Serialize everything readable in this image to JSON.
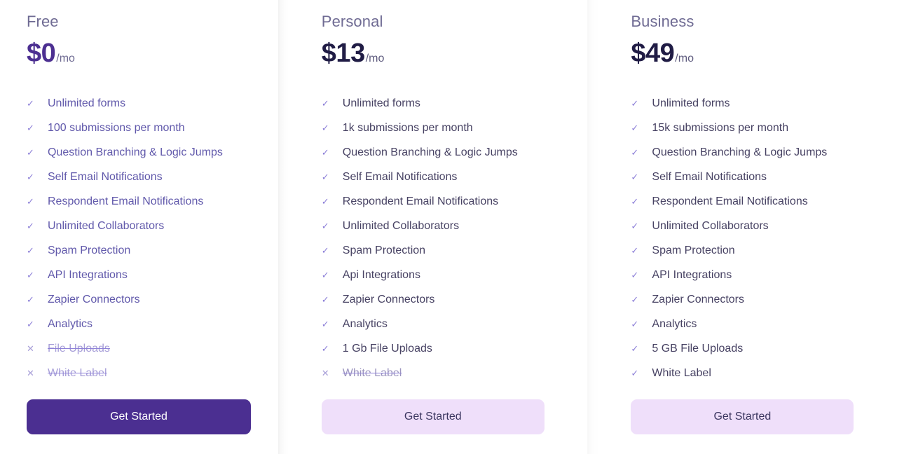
{
  "plans": [
    {
      "name": "Free",
      "price": "$0",
      "period": "/mo",
      "cta_label": "Get Started",
      "features": [
        {
          "label": "Unlimited forms",
          "included": true,
          "mark": "check-icon"
        },
        {
          "label": "100 submissions per month",
          "included": true,
          "mark": "check-icon"
        },
        {
          "label": "Question Branching & Logic Jumps",
          "included": true,
          "mark": "check-icon"
        },
        {
          "label": "Self Email Notifications",
          "included": true,
          "mark": "check-icon"
        },
        {
          "label": "Respondent Email Notifications",
          "included": true,
          "mark": "check-icon"
        },
        {
          "label": "Unlimited Collaborators",
          "included": true,
          "mark": "check-icon"
        },
        {
          "label": "Spam Protection",
          "included": true,
          "mark": "check-icon"
        },
        {
          "label": "API Integrations",
          "included": true,
          "mark": "check-icon"
        },
        {
          "label": "Zapier Connectors",
          "included": true,
          "mark": "check-icon"
        },
        {
          "label": "Analytics",
          "included": true,
          "mark": "check-icon"
        },
        {
          "label": "File Uploads",
          "included": false,
          "mark": "cross-icon"
        },
        {
          "label": "White Label",
          "included": false,
          "mark": "cross-icon"
        }
      ]
    },
    {
      "name": "Personal",
      "price": "$13",
      "period": "/mo",
      "cta_label": "Get Started",
      "features": [
        {
          "label": "Unlimited forms",
          "included": true,
          "mark": "check-icon"
        },
        {
          "label": "1k submissions per month",
          "included": true,
          "mark": "check-icon"
        },
        {
          "label": "Question Branching & Logic Jumps",
          "included": true,
          "mark": "check-icon"
        },
        {
          "label": "Self Email Notifications",
          "included": true,
          "mark": "check-icon"
        },
        {
          "label": "Respondent Email Notifications",
          "included": true,
          "mark": "check-icon"
        },
        {
          "label": "Unlimited Collaborators",
          "included": true,
          "mark": "check-icon"
        },
        {
          "label": "Spam Protection",
          "included": true,
          "mark": "check-icon"
        },
        {
          "label": "Api Integrations",
          "included": true,
          "mark": "check-icon"
        },
        {
          "label": "Zapier Connectors",
          "included": true,
          "mark": "check-icon"
        },
        {
          "label": "Analytics",
          "included": true,
          "mark": "check-icon"
        },
        {
          "label": "1 Gb File Uploads",
          "included": true,
          "mark": "check-icon"
        },
        {
          "label": "White Label",
          "included": false,
          "mark": "cross-icon"
        }
      ]
    },
    {
      "name": "Business",
      "price": "$49",
      "period": "/mo",
      "cta_label": "Get Started",
      "features": [
        {
          "label": "Unlimited forms",
          "included": true,
          "mark": "check-icon"
        },
        {
          "label": "15k submissions per month",
          "included": true,
          "mark": "check-icon"
        },
        {
          "label": "Question Branching & Logic Jumps",
          "included": true,
          "mark": "check-icon"
        },
        {
          "label": "Self Email Notifications",
          "included": true,
          "mark": "check-icon"
        },
        {
          "label": "Respondent Email Notifications",
          "included": true,
          "mark": "check-icon"
        },
        {
          "label": "Unlimited Collaborators",
          "included": true,
          "mark": "check-icon"
        },
        {
          "label": "Spam Protection",
          "included": true,
          "mark": "check-icon"
        },
        {
          "label": "API Integrations",
          "included": true,
          "mark": "check-icon"
        },
        {
          "label": "Zapier Connectors",
          "included": true,
          "mark": "check-icon"
        },
        {
          "label": "Analytics",
          "included": true,
          "mark": "check-icon"
        },
        {
          "label": "5 GB File Uploads",
          "included": true,
          "mark": "check-icon"
        },
        {
          "label": "White Label",
          "included": true,
          "mark": "check-icon"
        }
      ]
    }
  ],
  "glyphs": {
    "check": "✓",
    "cross": "✕"
  },
  "colors": {
    "primary_purple": "#4b2f91",
    "soft_purple_bg": "#efdffa",
    "check_purple": "#8d80d8",
    "free_text": "#6159ab",
    "paid_text": "#474263",
    "plan_name": "#6f6b93",
    "price_dark": "#201c45"
  }
}
